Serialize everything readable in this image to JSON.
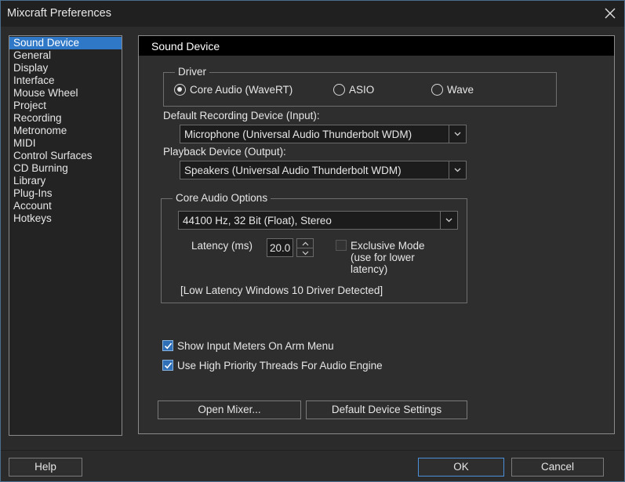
{
  "window": {
    "title": "Mixcraft Preferences"
  },
  "sidebar": {
    "items": [
      {
        "label": "Sound Device",
        "selected": true
      },
      {
        "label": "General"
      },
      {
        "label": "Display"
      },
      {
        "label": "Interface"
      },
      {
        "label": "Mouse Wheel"
      },
      {
        "label": "Project"
      },
      {
        "label": "Recording"
      },
      {
        "label": "Metronome"
      },
      {
        "label": "MIDI"
      },
      {
        "label": "Control Surfaces"
      },
      {
        "label": "CD Burning"
      },
      {
        "label": "Library"
      },
      {
        "label": "Plug-Ins"
      },
      {
        "label": "Account"
      },
      {
        "label": "Hotkeys"
      }
    ]
  },
  "panel": {
    "title": "Sound Device",
    "driver": {
      "legend": "Driver",
      "options": [
        "Core Audio (WaveRT)",
        "ASIO",
        "Wave"
      ],
      "selected": "Core Audio (WaveRT)"
    },
    "recording_device": {
      "label": "Default Recording Device (Input):",
      "value": "Microphone (Universal Audio Thunderbolt WDM)"
    },
    "playback_device": {
      "label": "Playback Device (Output):",
      "value": "Speakers (Universal Audio Thunderbolt WDM)"
    },
    "core_audio": {
      "legend": "Core Audio Options",
      "format": "44100 Hz, 32 Bit (Float), Stereo",
      "latency_label": "Latency (ms)",
      "latency_value": "20.0",
      "exclusive_label": "Exclusive Mode",
      "exclusive_sub1": "(use for lower",
      "exclusive_sub2": "latency)",
      "exclusive_checked": false,
      "status": "[Low Latency Windows 10 Driver Detected]"
    },
    "show_input_meters": {
      "label": "Show Input Meters On Arm Menu",
      "checked": true
    },
    "high_priority": {
      "label": "Use High Priority Threads For Audio Engine",
      "checked": true
    },
    "open_mixer": "Open Mixer...",
    "default_device_settings": "Default Device Settings"
  },
  "footer": {
    "help": "Help",
    "ok": "OK",
    "cancel": "Cancel"
  },
  "colors": {
    "selection": "#2f78c8",
    "background": "#2b2b2b",
    "focus_border": "#4a8fd8"
  }
}
